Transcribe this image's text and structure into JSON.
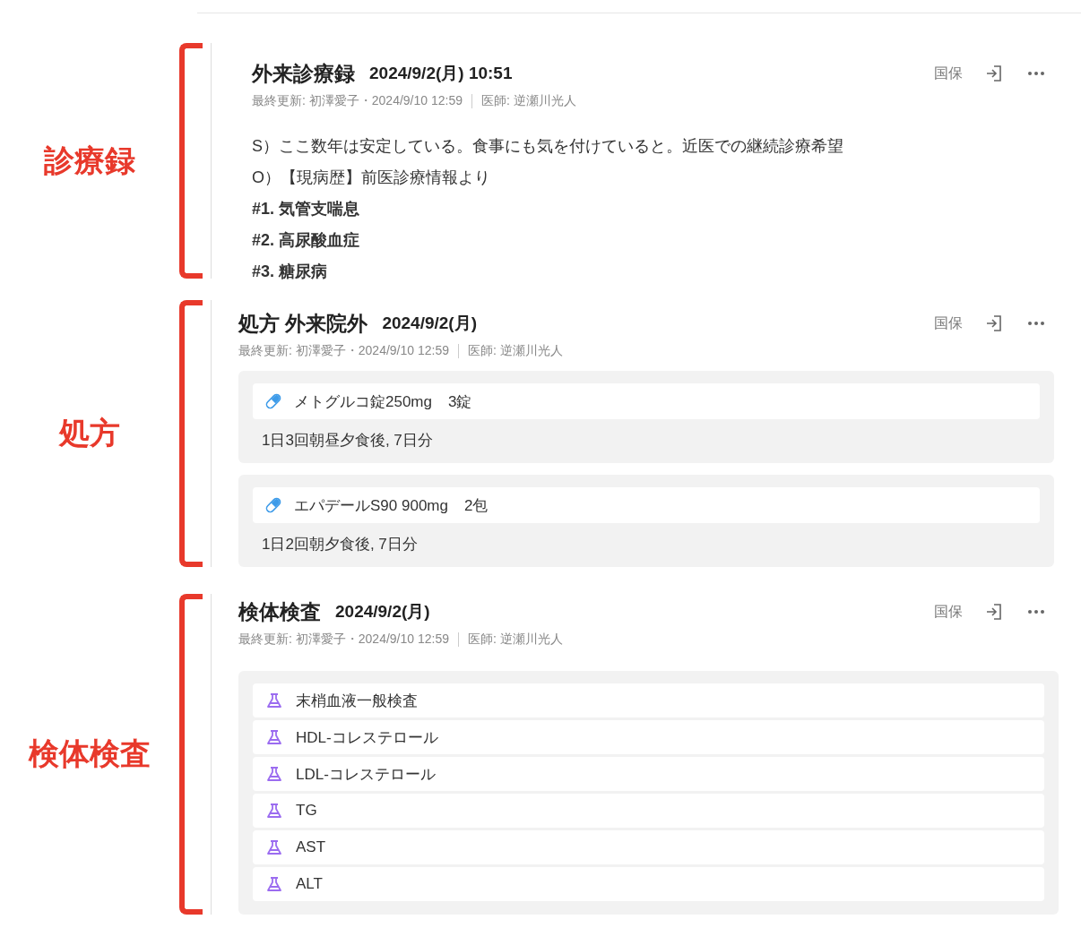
{
  "sections": [
    {
      "kind": "note",
      "annotation": "診療録",
      "title": "外来診療録",
      "datetime": "2024/9/2(月) 10:51",
      "updated": "最終更新: 初澤愛子・2024/9/10 12:59",
      "doctor": "医師: 逆瀬川光人",
      "insurance": "国保",
      "lines": [
        {
          "text": "S）ここ数年は安定している。食事にも気を付けていると。近医での継続診療希望",
          "bold": false
        },
        {
          "text": "O）【現病歴】前医診療情報より",
          "bold": false
        },
        {
          "text": "#1. 気管支喘息",
          "bold": true
        },
        {
          "text": "#2. 高尿酸血症",
          "bold": true
        },
        {
          "text": "#3. 糖尿病",
          "bold": true
        }
      ]
    },
    {
      "kind": "prescription",
      "annotation": "処方",
      "title": "処方 外来院外",
      "datetime": "2024/9/2(月)",
      "updated": "最終更新: 初澤愛子・2024/9/10 12:59",
      "doctor": "医師: 逆瀬川光人",
      "insurance": "国保",
      "drugs": [
        {
          "name": "メトグルコ錠250mg",
          "quantity": "3錠",
          "usage": "1日3回朝昼夕食後, 7日分"
        },
        {
          "name": "エパデールS90 900mg",
          "quantity": "2包",
          "usage": "1日2回朝夕食後, 7日分"
        }
      ]
    },
    {
      "kind": "lab",
      "annotation": "検体検査",
      "title": "検体検査",
      "datetime": "2024/9/2(月)",
      "updated": "最終更新: 初澤愛子・2024/9/10 12:59",
      "doctor": "医師: 逆瀬川光人",
      "insurance": "国保",
      "tests": [
        "末梢血液一般検査",
        "HDL-コレステロール",
        "LDL-コレステロール",
        "TG",
        "AST",
        "ALT"
      ]
    }
  ]
}
